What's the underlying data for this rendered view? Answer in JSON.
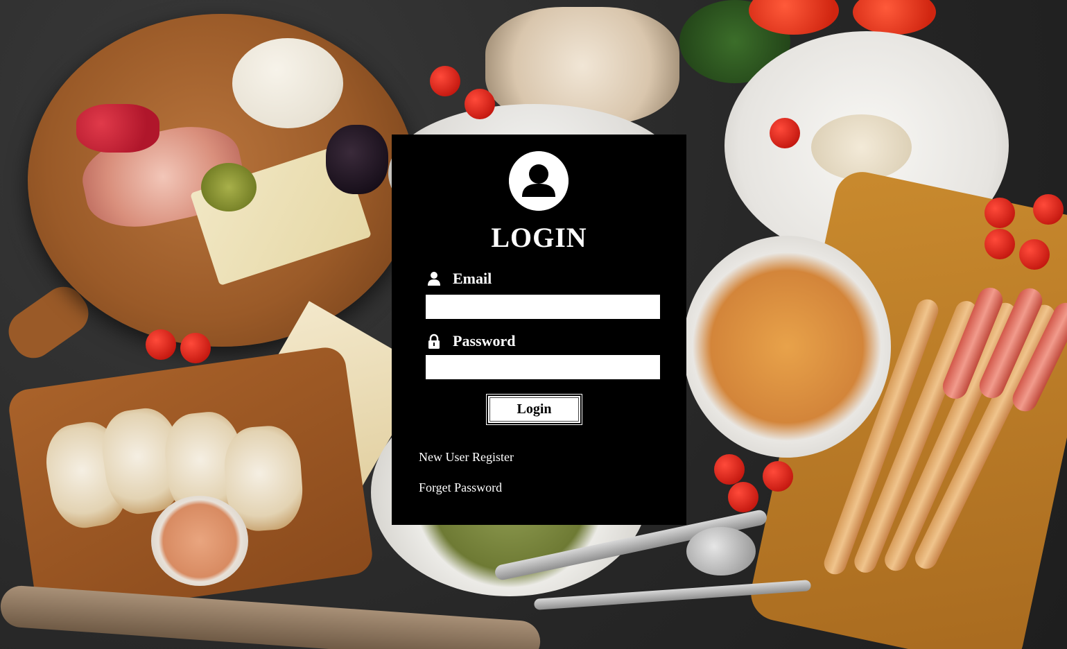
{
  "login": {
    "title": "LOGIN",
    "email_label": "Email",
    "email_value": "",
    "password_label": "Password",
    "password_value": "",
    "submit_label": "Login",
    "register_link": "New User Register",
    "forgot_link": "Forget Password"
  },
  "icons": {
    "avatar": "user-circle-icon",
    "email": "user-icon",
    "password": "lock-icon"
  },
  "colors": {
    "panel_background": "#000000",
    "panel_text": "#ffffff",
    "input_background": "#ffffff",
    "button_background": "#ffffff",
    "button_text": "#000000"
  }
}
